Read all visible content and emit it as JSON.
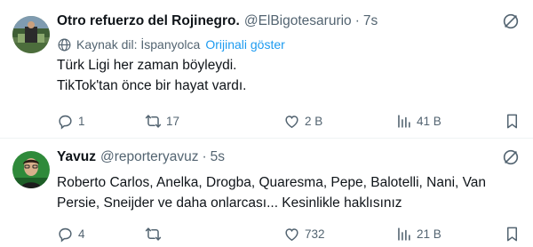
{
  "tweets": [
    {
      "display_name": "Otro refuerzo del Rojinegro.",
      "handle": "@ElBigotesarurio",
      "separator": "·",
      "time": "7s",
      "translate": {
        "label": "Kaynak dil: İspanyolca",
        "action": "Orijinali göster"
      },
      "text_lines": [
        "Türk Ligi her zaman böyleydi.",
        "TikTok'tan önce bir hayat vardı."
      ],
      "stats": {
        "replies": "1",
        "reposts": "17",
        "likes": "2 B",
        "views": "41 B"
      }
    },
    {
      "display_name": "Yavuz",
      "handle": "@reporteryavuz",
      "separator": "·",
      "time": "5s",
      "text_lines": [
        "Roberto Carlos, Anelka, Drogba, Quaresma, Pepe, Balotelli, Nani, Van",
        "Persie, Sneijder ve daha onlarcası... Kesinlikle haklısınız"
      ],
      "stats": {
        "replies": "4",
        "reposts": "",
        "likes": "732",
        "views": "21 B"
      }
    }
  ],
  "colors": {
    "text": "#0f1419",
    "muted": "#536471",
    "link": "#1d9bf0",
    "divider": "#eff3f4"
  },
  "icons": [
    "more-icon",
    "globe-icon",
    "reply-icon",
    "retweet-icon",
    "like-icon",
    "views-icon",
    "bookmark-icon"
  ]
}
